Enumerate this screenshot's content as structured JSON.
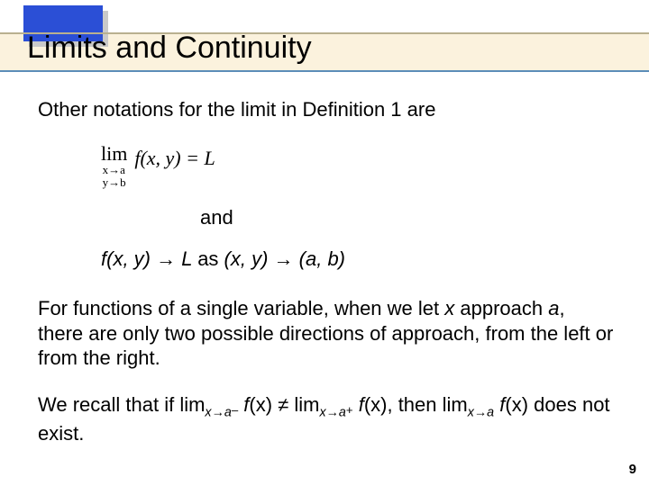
{
  "title": "Limits and Continuity",
  "para1": "Other notations for the limit in Definition 1 are",
  "eq": {
    "lim": "lim",
    "sub1": "x→a",
    "sub2": "y→b",
    "fxy": "f(x, y) = L",
    "and": "and"
  },
  "line2": {
    "fxy": "f",
    "args": "(x, y) ",
    "arrow1": "→",
    "L": " L ",
    "as": "as ",
    "xy": "(x, y) ",
    "arrow2": "→",
    "ab": " (a, b)"
  },
  "para2_a": "For functions of a single variable, when we let ",
  "para2_x": "x",
  "para2_b": " approach ",
  "para2_a2": "a",
  "para2_c": ", there are only two possible directions of approach, from the left or from the right.",
  "para3_a": "We recall that if lim",
  "para3_sub1": "x→a",
  "para3_minus": "–",
  "para3_b": " f",
  "para3_c": "(x) ≠ lim",
  "para3_sub2": "x→a",
  "para3_plus": "+",
  "para3_d": " f",
  "para3_e": "(x), then lim",
  "para3_sub3": "x→a",
  "para3_f": " f",
  "para3_g": "(x) does not exist.",
  "page_number": "9"
}
